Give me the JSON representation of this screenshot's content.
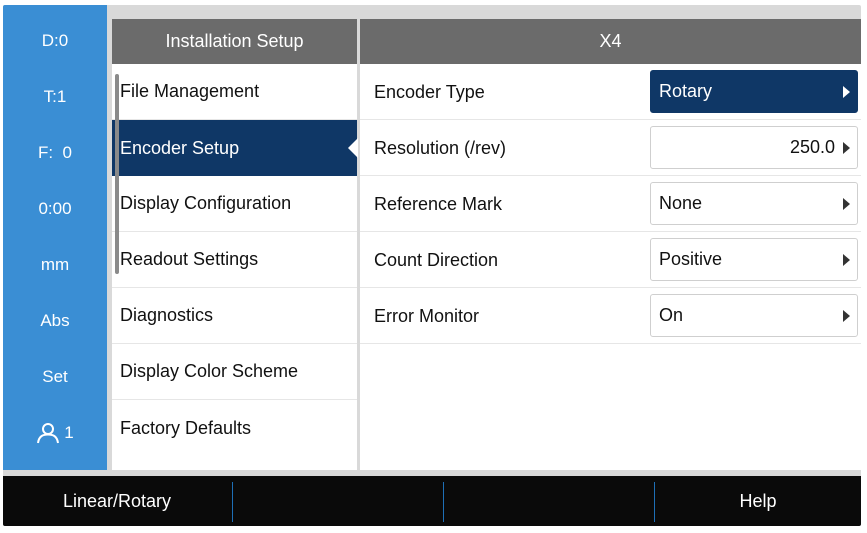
{
  "status_bar": {
    "items": [
      "D:0",
      "T:1",
      "F:  0",
      "0:00",
      "mm",
      "Abs",
      "Set"
    ],
    "user_number": "1"
  },
  "menu": {
    "title": "Installation Setup",
    "items": [
      {
        "label": "File Management"
      },
      {
        "label": "Encoder Setup",
        "selected": true
      },
      {
        "label": "Display Configuration"
      },
      {
        "label": "Readout Settings"
      },
      {
        "label": "Diagnostics"
      },
      {
        "label": "Display Color Scheme"
      },
      {
        "label": "Factory Defaults"
      }
    ]
  },
  "panel": {
    "title": "X4",
    "rows": [
      {
        "label": "Encoder Type",
        "value": "Rotary"
      },
      {
        "label": "Resolution (/rev)",
        "value": "250.0"
      },
      {
        "label": "Reference Mark",
        "value": "None"
      },
      {
        "label": "Count Direction",
        "value": "Positive"
      },
      {
        "label": "Error Monitor",
        "value": "On"
      }
    ]
  },
  "softkeys": [
    "Linear/Rotary",
    "",
    "",
    "Help"
  ],
  "colors": {
    "status_bar": "#3a8ed4",
    "header": "#6b6b6b",
    "selected": "#0f3766",
    "softkey_bar": "#0a0a0a"
  }
}
